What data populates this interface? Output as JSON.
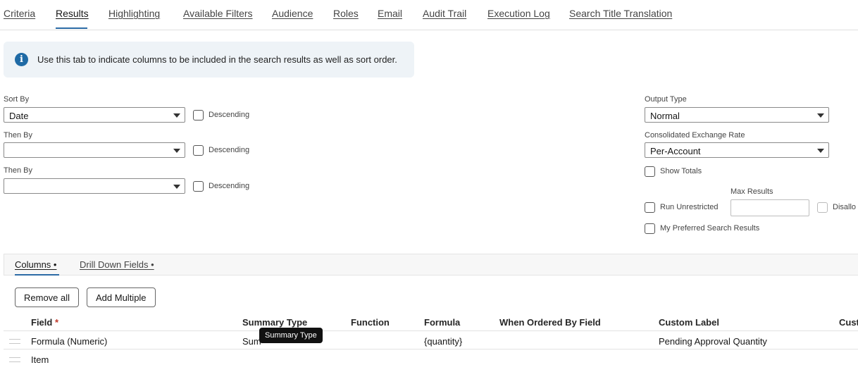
{
  "tabs": [
    {
      "label": "Criteria"
    },
    {
      "label": "Results"
    },
    {
      "label": "Highlighting"
    },
    {
      "label": "Available Filters"
    },
    {
      "label": "Audience"
    },
    {
      "label": "Roles"
    },
    {
      "label": "Email"
    },
    {
      "label": "Audit Trail"
    },
    {
      "label": "Execution Log"
    },
    {
      "label": "Search Title Translation"
    }
  ],
  "active_tab": "Results",
  "info": {
    "text": "Use this tab to indicate columns to be included in the search results as well as sort order.",
    "icon": "info-icon"
  },
  "sort": {
    "sort_by_label": "Sort By",
    "sort_by_value": "Date",
    "then_by_label": "Then By",
    "then_by_value": "",
    "then_by2_label": "Then By",
    "then_by2_value": "",
    "descending_label": "Descending"
  },
  "output": {
    "output_type_label": "Output Type",
    "output_type_value": "Normal",
    "exchange_rate_label": "Consolidated Exchange Rate",
    "exchange_rate_value": "Per-Account",
    "show_totals_label": "Show Totals",
    "max_results_label": "Max Results",
    "run_unrestricted_label": "Run Unrestricted",
    "disallow_label": "Disallo",
    "preferred_label": "My Preferred Search Results"
  },
  "subtabs": [
    {
      "label": "Columns •"
    },
    {
      "label": "Drill Down Fields •"
    }
  ],
  "buttons": {
    "remove_all": "Remove all",
    "add_multiple": "Add Multiple"
  },
  "table": {
    "headers": {
      "field": "Field",
      "required_mark": "*",
      "summary_type": "Summary Type",
      "function": "Function",
      "formula": "Formula",
      "when_ordered": "When Ordered By Field",
      "custom_label": "Custom Label",
      "cust": "Cust"
    },
    "rows": [
      {
        "field": "Formula (Numeric)",
        "summary_type": "Sum",
        "formula": "{quantity}",
        "custom_label": "Pending Approval Quantity"
      },
      {
        "field": "Item",
        "summary_type": "",
        "formula": "",
        "custom_label": ""
      }
    ]
  },
  "tooltip": {
    "text": "Summary Type"
  }
}
